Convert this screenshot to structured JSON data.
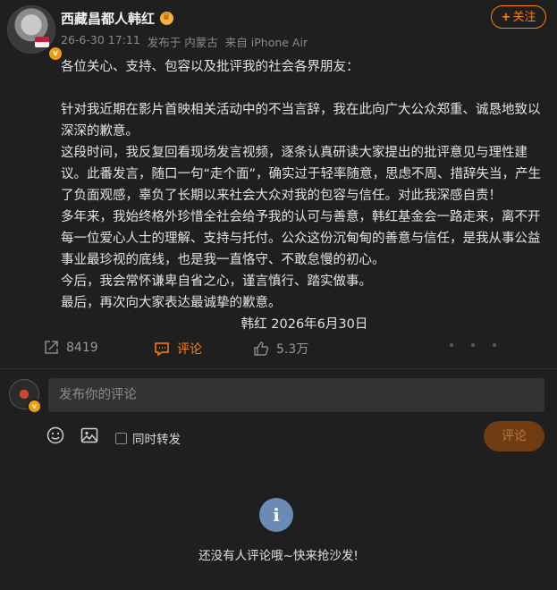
{
  "author": {
    "name": "西藏昌都人韩红",
    "avatar_alt": "avatar",
    "badge": "v"
  },
  "meta": {
    "time": "26-6-30 17:11",
    "location": "发布于 内蒙古",
    "device": "来自 iPhone Air"
  },
  "follow_button": {
    "plus": "+",
    "label": "关注"
  },
  "post": {
    "greeting": "各位关心、支持、包容以及批评我的社会各界朋友：",
    "paragraphs": [
      "针对我近期在影片首映相关活动中的不当言辞，我在此向广大公众郑重、诚恳地致以深深的歉意。",
      "这段时间，我反复回看现场发言视频，逐条认真研读大家提出的批评意见与理性建议。此番发言，随口一句“走个面”，确实过于轻率随意，思虑不周、措辞失当，产生了负面观感，辜负了长期以来社会大众对我的包容与信任。对此我深感自责！",
      "多年来，我始终格外珍惜全社会给予我的认可与善意，韩红基金会一路走来，离不开每一位爱心人士的理解、支持与托付。公众这份沉甸甸的善意与信任，是我从事公益事业最珍视的底线，也是我一直恪守、不敢怠慢的初心。",
      "今后，我会常怀谦卑自省之心，谨言慎行、踏实做事。",
      "最后，再次向大家表达最诚挚的歉意。"
    ],
    "signature": "韩红 2026年6月30日"
  },
  "actions": {
    "repost_count": "8419",
    "comment_label": "评论",
    "like_count": "5.3万"
  },
  "comment_box": {
    "placeholder": "发布你的评论",
    "repost_label": "同时转发",
    "submit_label": "评论"
  },
  "empty_state": {
    "icon": "i",
    "text": "还没有人评论哦~快来抢沙发!"
  },
  "colors": {
    "background": "#1f1f1f",
    "accent": "#ff8200",
    "input_bg": "#333333"
  }
}
